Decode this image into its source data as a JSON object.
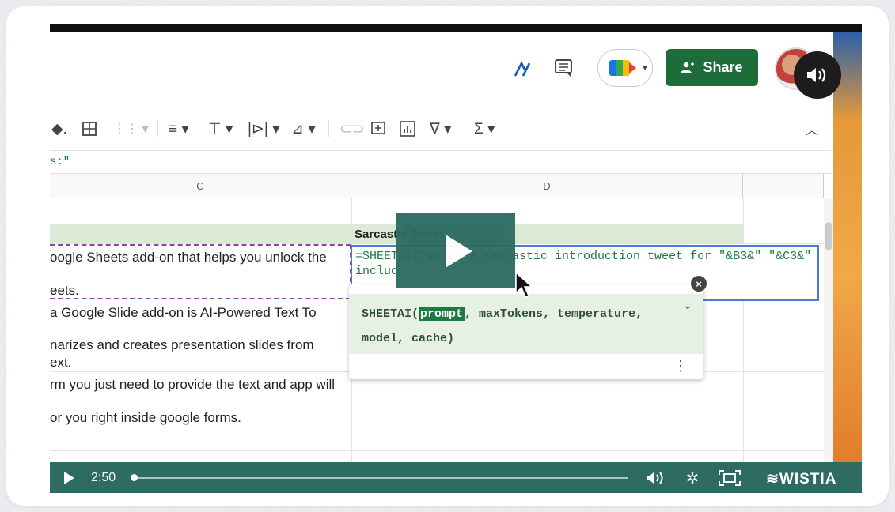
{
  "header": {
    "share_label": "Share",
    "icons": [
      "annotate-icon",
      "comment-icon",
      "meet-icon",
      "share-people-icon",
      "avatar",
      "volume-icon"
    ]
  },
  "toolbar": {
    "icons": [
      "paint-fill-icon",
      "borders-icon",
      "merge-icon",
      "align-icon",
      "vertical-align-icon",
      "text-wrap-icon",
      "text-rotate-icon",
      "link-icon",
      "comment-add-icon",
      "chart-icon",
      "filter-icon",
      "functions-icon",
      "collapse-icon"
    ]
  },
  "formula_bar": {
    "text": "s:\""
  },
  "columns": {
    "c": "C",
    "d": "D"
  },
  "cells": {
    "d_header": "Sarcastic Tweet",
    "c_rows": [
      "oogle Sheets add-on that helps you unlock the",
      "eets.",
      " a Google Slide add-on is AI-Powered Text To",
      "narizes and creates presentation slides from",
      "ext.",
      "rm you just need to provide the text and app will",
      "or you right inside google forms."
    ]
  },
  "edit_cell": {
    "line1": "=SHEETAI(\"Write a sarcastic introduction tweet for \"&B3&\" \"&C3&\"",
    "line2": "includ"
  },
  "autocomplete": {
    "fn": "SHEETAI(",
    "highlighted": "prompt",
    "rest1": ", maxTokens, temperature,",
    "rest2": "model, cache)"
  },
  "player": {
    "time": "2:50",
    "progress": 0.005,
    "brand": "WISTIA",
    "colors": {
      "accent": "#2d6b63",
      "share": "#1e6b3c"
    }
  }
}
